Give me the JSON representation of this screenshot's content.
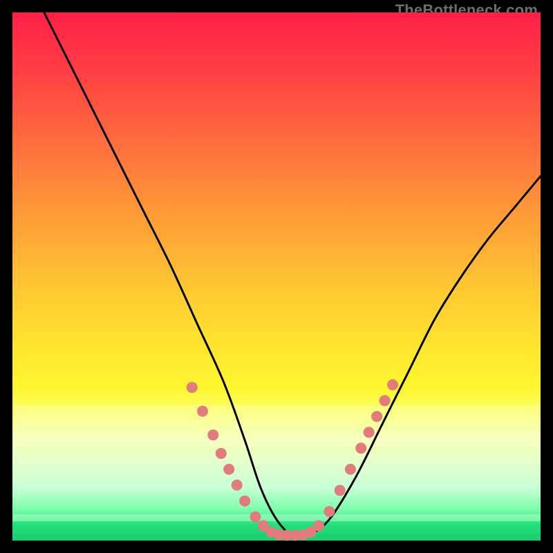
{
  "watermark": "TheBottleneck.com",
  "colors": {
    "top": "#ff1f46",
    "mid": "#ffe72f",
    "bottom": "#18d06f",
    "dot": "#e27b7b",
    "curve": "#000000"
  },
  "chart_data": {
    "type": "line",
    "title": "",
    "xlabel": "",
    "ylabel": "",
    "xlim": [
      0,
      100
    ],
    "ylim": [
      0,
      100
    ],
    "grid": false,
    "series": [
      {
        "name": "bottleneck-curve",
        "x": [
          0,
          5,
          10,
          15,
          20,
          25,
          30,
          35,
          40,
          44,
          47,
          50,
          53,
          56,
          60,
          65,
          70,
          75,
          80,
          85,
          90,
          95,
          100
        ],
        "y": [
          112,
          102,
          92,
          82,
          72,
          62,
          52,
          41,
          30,
          19,
          10,
          4,
          1,
          1,
          4,
          12,
          22,
          32,
          42,
          50,
          57,
          63,
          69
        ]
      }
    ],
    "markers": [
      {
        "series": "bottleneck-curve",
        "x": 34,
        "y": 29
      },
      {
        "series": "bottleneck-curve",
        "x": 36,
        "y": 24.5
      },
      {
        "series": "bottleneck-curve",
        "x": 38,
        "y": 20
      },
      {
        "series": "bottleneck-curve",
        "x": 39.5,
        "y": 16.5
      },
      {
        "series": "bottleneck-curve",
        "x": 41,
        "y": 13.5
      },
      {
        "series": "bottleneck-curve",
        "x": 42.5,
        "y": 10.5
      },
      {
        "series": "bottleneck-curve",
        "x": 44,
        "y": 7.5
      },
      {
        "series": "bottleneck-curve",
        "x": 46,
        "y": 4.5
      },
      {
        "series": "bottleneck-curve",
        "x": 47.5,
        "y": 2.8
      },
      {
        "series": "bottleneck-curve",
        "x": 49,
        "y": 1.6
      },
      {
        "series": "bottleneck-curve",
        "x": 50.5,
        "y": 1.1
      },
      {
        "series": "bottleneck-curve",
        "x": 52,
        "y": 1.0
      },
      {
        "series": "bottleneck-curve",
        "x": 53.5,
        "y": 1.0
      },
      {
        "series": "bottleneck-curve",
        "x": 55,
        "y": 1.1
      },
      {
        "series": "bottleneck-curve",
        "x": 56.5,
        "y": 1.6
      },
      {
        "series": "bottleneck-curve",
        "x": 58,
        "y": 2.8
      },
      {
        "series": "bottleneck-curve",
        "x": 60,
        "y": 5.5
      },
      {
        "series": "bottleneck-curve",
        "x": 62,
        "y": 9.5
      },
      {
        "series": "bottleneck-curve",
        "x": 64,
        "y": 13.5
      },
      {
        "series": "bottleneck-curve",
        "x": 66,
        "y": 17.5
      },
      {
        "series": "bottleneck-curve",
        "x": 67.5,
        "y": 20.5
      },
      {
        "series": "bottleneck-curve",
        "x": 69,
        "y": 23.5
      },
      {
        "series": "bottleneck-curve",
        "x": 70.5,
        "y": 26.5
      },
      {
        "series": "bottleneck-curve",
        "x": 72,
        "y": 29.5
      }
    ]
  }
}
